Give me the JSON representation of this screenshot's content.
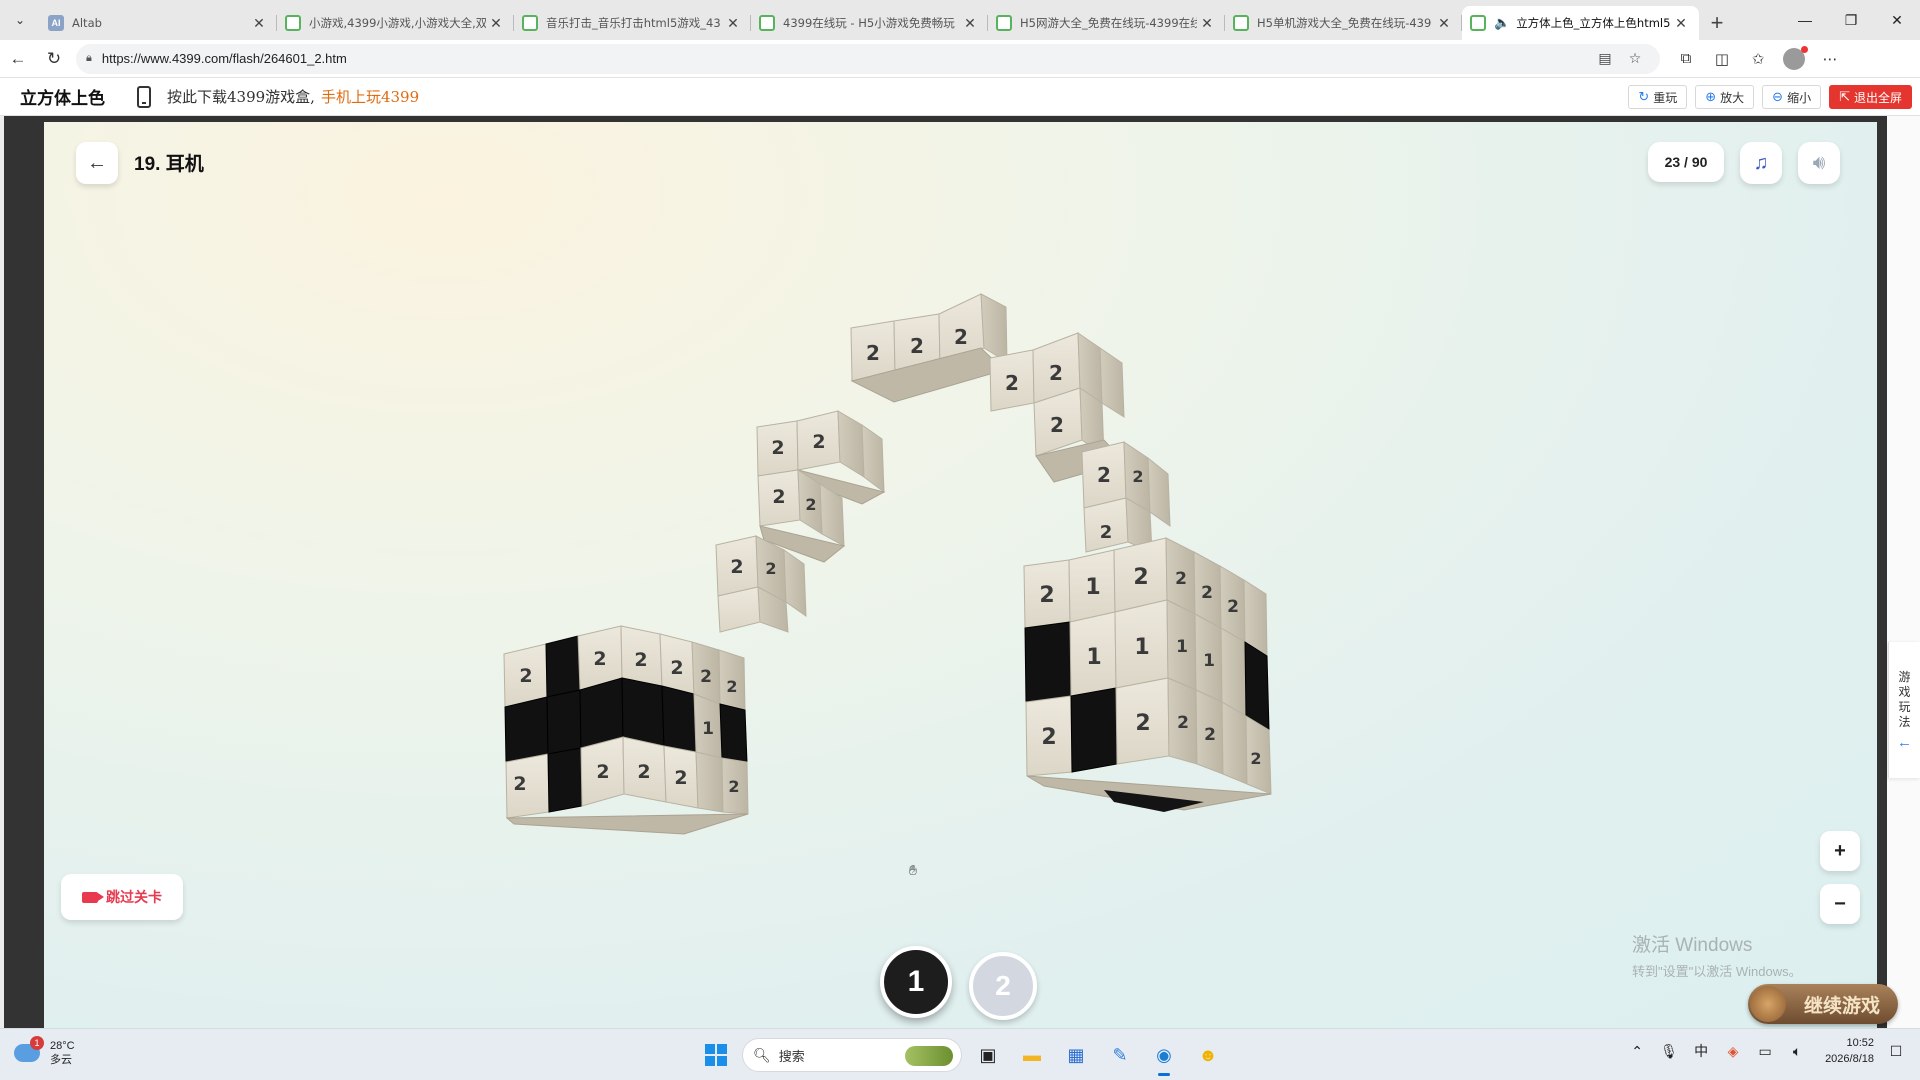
{
  "browser": {
    "tabs": [
      {
        "title": "Altab",
        "favicon": "ai-icon",
        "active": false
      },
      {
        "title": "小游戏,4399小游戏,小游戏大全,双",
        "favicon": "grid-icon",
        "active": false
      },
      {
        "title": "音乐打击_音乐打击html5游戏_43",
        "favicon": "grid-icon",
        "active": false
      },
      {
        "title": "4399在线玩 - H5小游戏免费畅玩",
        "favicon": "grid-icon",
        "active": false
      },
      {
        "title": "H5网游大全_免费在线玩-4399在线",
        "favicon": "grid-icon",
        "active": false
      },
      {
        "title": "H5单机游戏大全_免费在线玩-439",
        "favicon": "grid-icon",
        "active": false
      },
      {
        "title": "立方体上色_立方体上色html5",
        "favicon": "grid-icon",
        "active": true
      }
    ],
    "url": "https://www.4399.com/flash/264601_2.htm"
  },
  "site": {
    "title": "立方体上色",
    "download_text": "按此下载4399游戏盒,",
    "download_link": "手机上玩4399",
    "buttons": {
      "replay": "重玩",
      "zoom_in": "放大",
      "zoom_out": "缩小",
      "exit_fullscreen": "退出全屏"
    },
    "side_tab": [
      "游",
      "戏",
      "玩",
      "法"
    ]
  },
  "game": {
    "level_title": "19. 耳机",
    "progress": "23 / 90",
    "skip_label": "跳过关卡",
    "zoom_in": "+",
    "zoom_out": "−",
    "number_buttons": [
      "1",
      "2"
    ],
    "continue_label": "继续游戏",
    "cube_numbers": {
      "headband": [
        "2",
        "2",
        "2",
        "2",
        "2",
        "2",
        "2",
        "2",
        "2",
        "2",
        "2",
        "2",
        "2",
        "2",
        "2"
      ],
      "left_earcup": [
        "2",
        "2",
        "2",
        "2",
        "2",
        "1",
        "2",
        "2",
        "2",
        "2",
        "2",
        "2"
      ],
      "right_earcup": [
        "2",
        "1",
        "2",
        "1",
        "1",
        "2",
        "2",
        "2",
        "2",
        "2",
        "1",
        "1",
        "2",
        "2",
        "2"
      ]
    },
    "colors": {
      "cube_face": "#e6e1d3",
      "cube_side": "#c8c2b2",
      "painted": "#111111",
      "accent_red": "#e8394f"
    }
  },
  "watermark": {
    "line1": "激活 Windows",
    "line2": "转到\"设置\"以激活 Windows。"
  },
  "taskbar": {
    "weather_temp": "28°C",
    "weather_desc": "多云",
    "weather_badge": "1",
    "search_placeholder": "搜索",
    "time": "10:52",
    "date": "2026/8/18"
  }
}
